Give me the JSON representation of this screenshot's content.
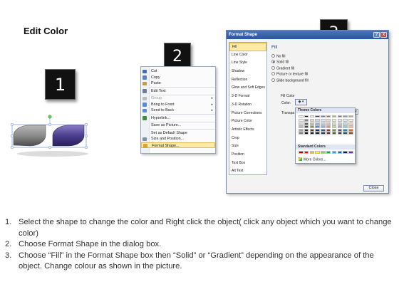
{
  "slide": {
    "title": "Edit Color"
  },
  "badges": [
    "1",
    "2",
    "3"
  ],
  "context_menu": {
    "items": [
      {
        "label": "Cut",
        "icon": "scissors-icon",
        "color": "#4a6ea9",
        "disabled": false,
        "submenu": false
      },
      {
        "label": "Copy",
        "icon": "copy-icon",
        "color": "#5d84c1",
        "disabled": false,
        "submenu": false
      },
      {
        "label": "Paste",
        "icon": "paste-icon",
        "color": "#c29a4a",
        "disabled": false,
        "submenu": false
      },
      {
        "sep": true
      },
      {
        "label": "Edit Text",
        "icon": "text-icon",
        "color": "#6b7fa3",
        "disabled": false,
        "submenu": false
      },
      {
        "sep": true
      },
      {
        "label": "Group",
        "icon": "group-icon",
        "color": "#bbbbbb",
        "disabled": true,
        "submenu": true
      },
      {
        "label": "Bring to Front",
        "icon": "bring-front-icon",
        "color": "#5c8ad0",
        "disabled": false,
        "submenu": true
      },
      {
        "label": "Send to Back",
        "icon": "send-back-icon",
        "color": "#5c8ad0",
        "disabled": false,
        "submenu": true
      },
      {
        "sep": true
      },
      {
        "label": "Hyperlink...",
        "icon": "hyperlink-icon",
        "color": "#3a8f3a",
        "disabled": false,
        "submenu": false
      },
      {
        "sep": true
      },
      {
        "label": "Save as Picture...",
        "icon": "",
        "color": "",
        "disabled": false,
        "submenu": false
      },
      {
        "sep": true
      },
      {
        "label": "Set as Default Shape",
        "icon": "",
        "color": "",
        "disabled": false,
        "submenu": false
      },
      {
        "label": "Size and Position...",
        "icon": "size-icon",
        "color": "#7a8fb8",
        "disabled": false,
        "submenu": false
      },
      {
        "label": "Format Shape...",
        "icon": "format-shape-icon",
        "color": "#d9a531",
        "disabled": false,
        "submenu": false,
        "highlighted": true
      }
    ]
  },
  "dialog": {
    "title": "Format Shape",
    "help": "?",
    "close": "x",
    "nav": [
      "Fill",
      "Line Color",
      "Line Style",
      "Shadow",
      "Reflection",
      "Glow and Soft Edges",
      "3-D Format",
      "3-D Rotation",
      "Picture Corrections",
      "Picture Color",
      "Artistic Effects",
      "Crop",
      "Size",
      "Position",
      "Text Box",
      "Alt Text"
    ],
    "nav_selected": "Fill",
    "fill_heading": "Fill",
    "options": [
      {
        "label": "No fill",
        "selected": false
      },
      {
        "label": "Solid fill",
        "selected": true
      },
      {
        "label": "Gradient fill",
        "selected": false
      },
      {
        "label": "Picture or texture fill",
        "selected": false
      },
      {
        "label": "Slide background fill",
        "selected": false
      }
    ],
    "fill_color_label": "Fill Color",
    "color_label": "Color:",
    "transparency_label": "Transpa",
    "transparency_spinner": "▴▾",
    "close_button": "Close"
  },
  "color_picker": {
    "theme_heading": "Theme Colors",
    "standard_heading": "Standard Colors",
    "more_colors": "More Colors...",
    "theme_columns": [
      [
        "#ffffff",
        "#f2f2f2",
        "#d9d9d9",
        "#bfbfbf",
        "#a6a6a6",
        "#808080"
      ],
      [
        "#000000",
        "#7f7f7f",
        "#595959",
        "#404040",
        "#262626",
        "#0d0d0d"
      ],
      [
        "#eeece1",
        "#ddd9c3",
        "#c4bd97",
        "#948a54",
        "#4a452a",
        "#1e1c11"
      ],
      [
        "#1f497d",
        "#c6d9f1",
        "#8db3e2",
        "#548dd4",
        "#17365d",
        "#0f243e"
      ],
      [
        "#4f81bd",
        "#dbe5f1",
        "#b8cce4",
        "#95b3d7",
        "#366092",
        "#244061"
      ],
      [
        "#c0504d",
        "#f2dcdb",
        "#e6b9b8",
        "#d99694",
        "#953735",
        "#632523"
      ],
      [
        "#9bbb59",
        "#ebf1de",
        "#d7e4bd",
        "#c3d69b",
        "#77933c",
        "#4f6228"
      ],
      [
        "#8064a2",
        "#e5e0ec",
        "#ccc1da",
        "#b3a2c7",
        "#60497a",
        "#403152"
      ],
      [
        "#4bacc6",
        "#dbeef4",
        "#b7dee8",
        "#93cddd",
        "#31859c",
        "#215968"
      ],
      [
        "#f79646",
        "#fdeada",
        "#fbd5b5",
        "#fac08f",
        "#e46c0a",
        "#984807"
      ]
    ],
    "standard": [
      "#c00000",
      "#ff0000",
      "#ffc000",
      "#ffff00",
      "#92d050",
      "#00b050",
      "#00b0f0",
      "#0070c0",
      "#002060",
      "#7030a0"
    ]
  },
  "instructions": [
    {
      "num": "1.",
      "text": "Select the shape to change the color and Right click the object( click any object which you want to change color)"
    },
    {
      "num": "2.",
      "text": "Choose Format Shape in the dialog box."
    },
    {
      "num": "3.",
      "text": "Choose “Fill” in the Format Shape box then “Solid” or “Gradient” depending on the appearance of the object. Change colour as shown in the picture."
    }
  ]
}
